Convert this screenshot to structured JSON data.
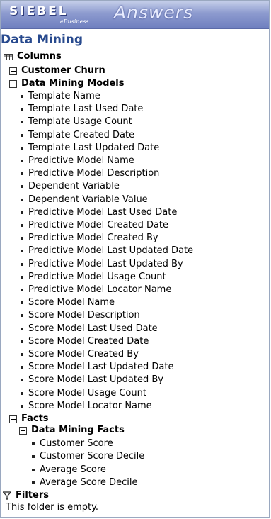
{
  "header": {
    "logo_siebel": "SIEBEL",
    "logo_ebusiness": "eBusiness",
    "logo_answers": "Answers"
  },
  "title": "Data Mining",
  "columns_label": "Columns",
  "customer_churn_label": "Customer Churn",
  "dmm_label": "Data Mining Models",
  "dmm_items": [
    "Template Name",
    "Template Last Used Date",
    "Template Usage Count",
    "Template Created Date",
    "Template Last Updated Date",
    "Predictive Model Name",
    "Predictive Model Description",
    "Dependent Variable",
    "Dependent Variable Value",
    "Predictive Model Last Used Date",
    "Predictive Model Created Date",
    "Predictive Model Created By",
    "Predictive Model Last Updated Date",
    "Predictive Model Last Updated By",
    "Predictive Model Usage Count",
    "Predictive Model Locator Name",
    "Score Model Name",
    "Score Model Description",
    "Score Model Last Used Date",
    "Score Model Created Date",
    "Score Model Created By",
    "Score Model Last Updated Date",
    "Score Model Last Updated By",
    "Score Model Usage Count",
    "Score Model Locator Name"
  ],
  "facts_label": "Facts",
  "dmf_label": "Data Mining Facts",
  "dmf_items": [
    "Customer Score",
    "Customer Score Decile",
    "Average Score",
    "Average Score Decile"
  ],
  "filters_label": "Filters",
  "filters_empty": "This folder is empty.",
  "colors": {
    "title": "#284a8e",
    "header_top": "#c6cfea",
    "header_bottom": "#6f7fbf"
  }
}
